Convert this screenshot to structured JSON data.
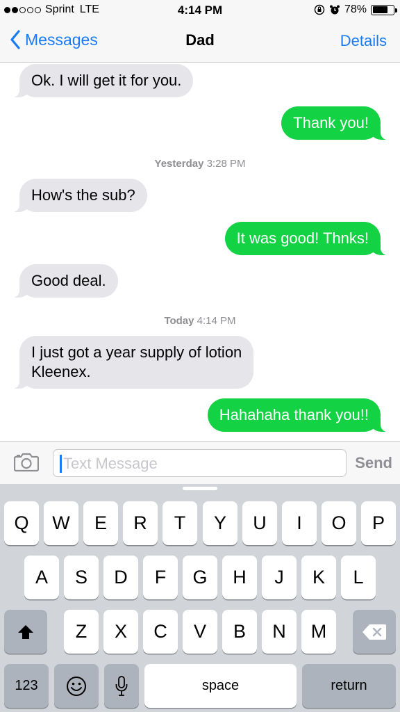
{
  "status_bar": {
    "carrier": "Sprint",
    "network": "LTE",
    "time": "4:14 PM",
    "battery_text": "78%",
    "battery_level": 0.78
  },
  "nav": {
    "back_label": "Messages",
    "title": "Dad",
    "details_label": "Details"
  },
  "messages": [
    {
      "kind": "incoming",
      "text": "Ok. I will get it for you."
    },
    {
      "kind": "outgoing",
      "text": "Thank you!"
    },
    {
      "kind": "timestamp",
      "day": "Yesterday",
      "time": "3:28 PM"
    },
    {
      "kind": "incoming",
      "text": "How's the sub?"
    },
    {
      "kind": "outgoing",
      "text": "It was good! Thnks!"
    },
    {
      "kind": "incoming",
      "text": "Good deal."
    },
    {
      "kind": "timestamp",
      "day": "Today",
      "time": "4:14 PM"
    },
    {
      "kind": "incoming",
      "line1": "I just got a year supply of lotion",
      "line2": "Kleenex."
    },
    {
      "kind": "outgoing",
      "text": "Hahahaha thank you!!"
    }
  ],
  "input": {
    "placeholder": "Text Message",
    "send_label": "Send"
  },
  "keyboard": {
    "row1": [
      "Q",
      "W",
      "E",
      "R",
      "T",
      "Y",
      "U",
      "I",
      "O",
      "P"
    ],
    "row2": [
      "A",
      "S",
      "D",
      "F",
      "G",
      "H",
      "J",
      "K",
      "L"
    ],
    "row3": [
      "Z",
      "X",
      "C",
      "V",
      "B",
      "N",
      "M"
    ],
    "numbers_label": "123",
    "space_label": "space",
    "return_label": "return"
  },
  "colors": {
    "ios_blue": "#1a7cf5",
    "outgoing_bubble": "#13d244",
    "incoming_bubble": "#e5e5ea"
  },
  "icons": [
    "back-chevron-icon",
    "camera-icon",
    "shift-icon",
    "delete-icon",
    "emoji-icon",
    "microphone-icon",
    "lock-rotation-icon",
    "alarm-icon",
    "battery-icon"
  ]
}
